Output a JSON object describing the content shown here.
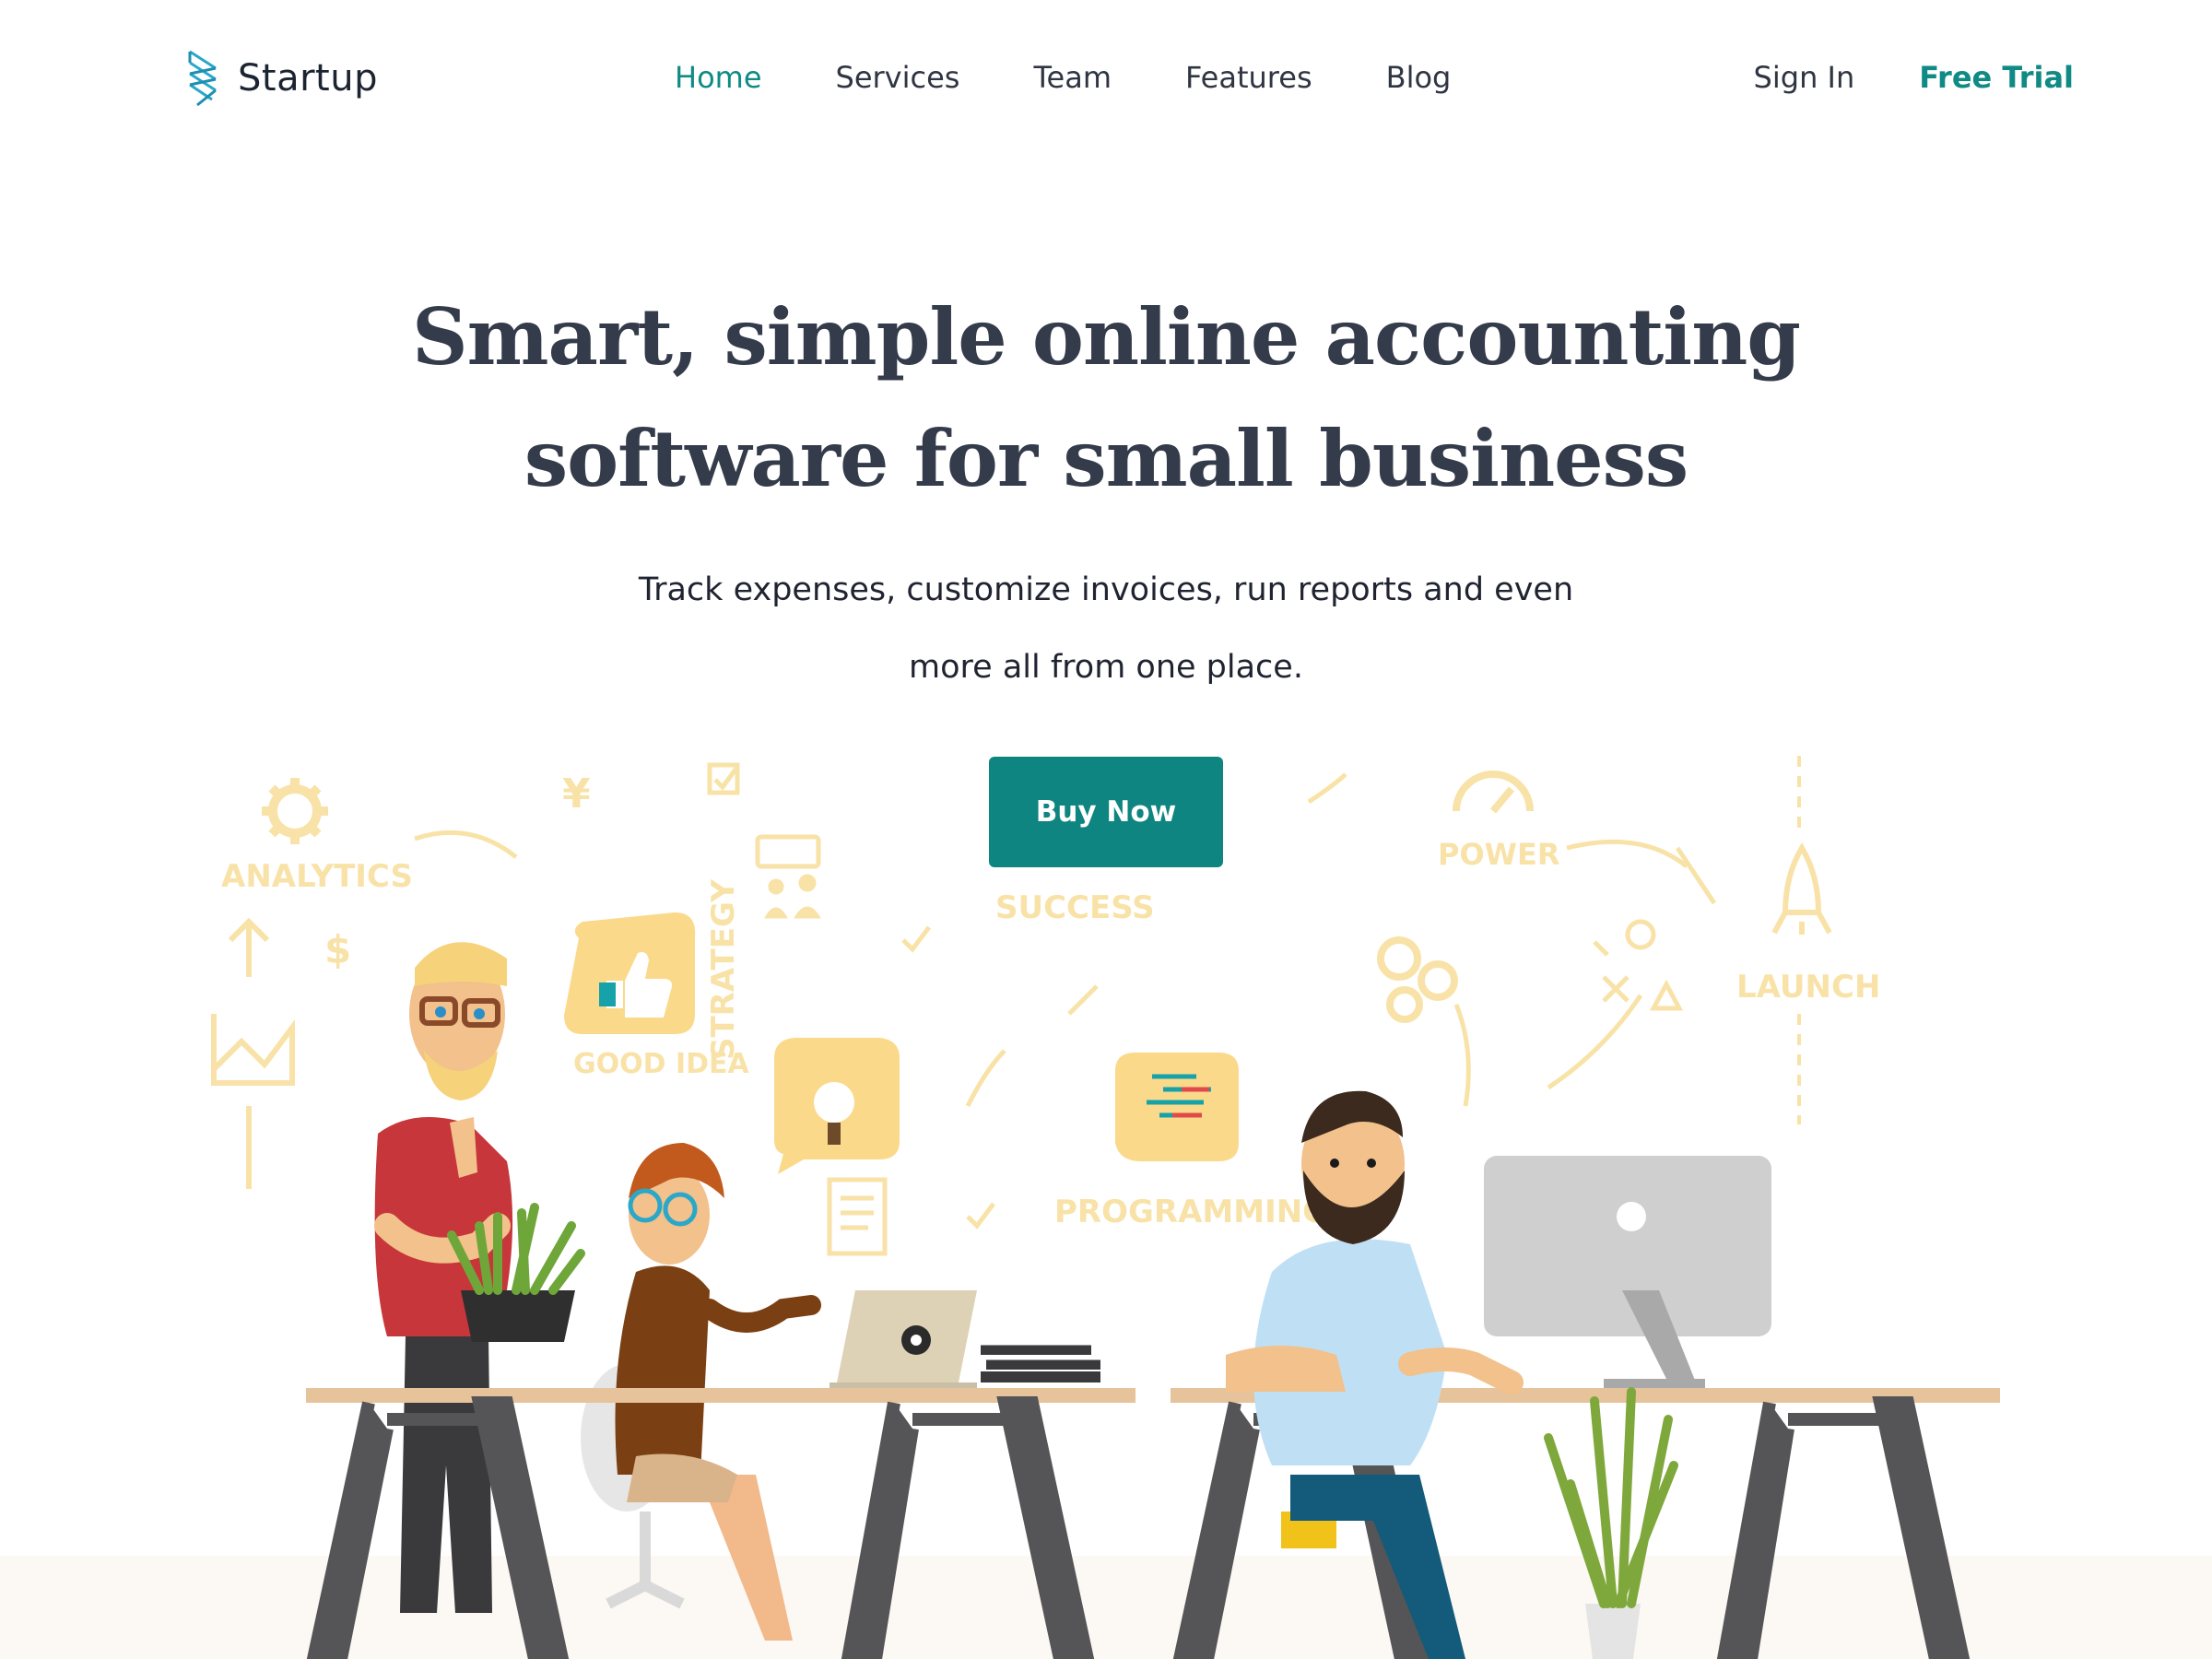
{
  "header": {
    "brand": "Startup",
    "nav": [
      {
        "label": "Home",
        "active": true
      },
      {
        "label": "Services",
        "active": false
      },
      {
        "label": "Team",
        "active": false
      },
      {
        "label": "Features",
        "active": false
      },
      {
        "label": "Blog",
        "active": false
      }
    ],
    "sign_in": "Sign In",
    "free_trial": "Free Trial"
  },
  "hero": {
    "title_line1": "Smart, simple online accounting",
    "title_line2": "software for small business",
    "subtitle_line1": "Track expenses, customize invoices, run reports and even",
    "subtitle_line2": "more all from one place.",
    "cta": "Buy Now"
  },
  "illustration": {
    "doodle_words": [
      "ANALYTICS",
      "SUCCESS",
      "POWER",
      "STRATEGY",
      "GOOD IDEA",
      "PROGRAMMING",
      "LAUNCH"
    ]
  },
  "colors": {
    "accent": "#0f8582",
    "heading": "#343b4a",
    "text": "#1f2430",
    "doodle": "#f6d98a"
  }
}
